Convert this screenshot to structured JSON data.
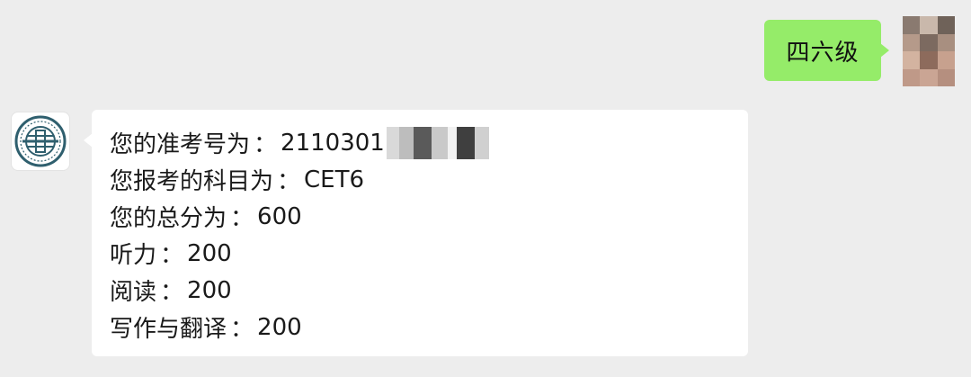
{
  "outgoing": {
    "text": "四六级",
    "bubble_color": "#95ec69"
  },
  "incoming": {
    "avatar_icon": "university-seal-icon",
    "lines": [
      {
        "label": "您的准考号为",
        "sep": "：",
        "value": "2110301",
        "redacted": true
      },
      {
        "label": "您报考的科目为",
        "sep": "：",
        "value": "CET6"
      },
      {
        "label": "您的总分为",
        "sep": "：",
        "value": "600"
      },
      {
        "label": "听力",
        "sep": "：",
        "value": "200"
      },
      {
        "label": "阅读",
        "sep": "：",
        "value": "200"
      },
      {
        "label": "写作与翻译",
        "sep": "：",
        "value": "200"
      }
    ]
  },
  "theme": {
    "background": "#ededed",
    "incoming_bubble": "#ffffff",
    "seal_color": "#2f5f6e"
  }
}
